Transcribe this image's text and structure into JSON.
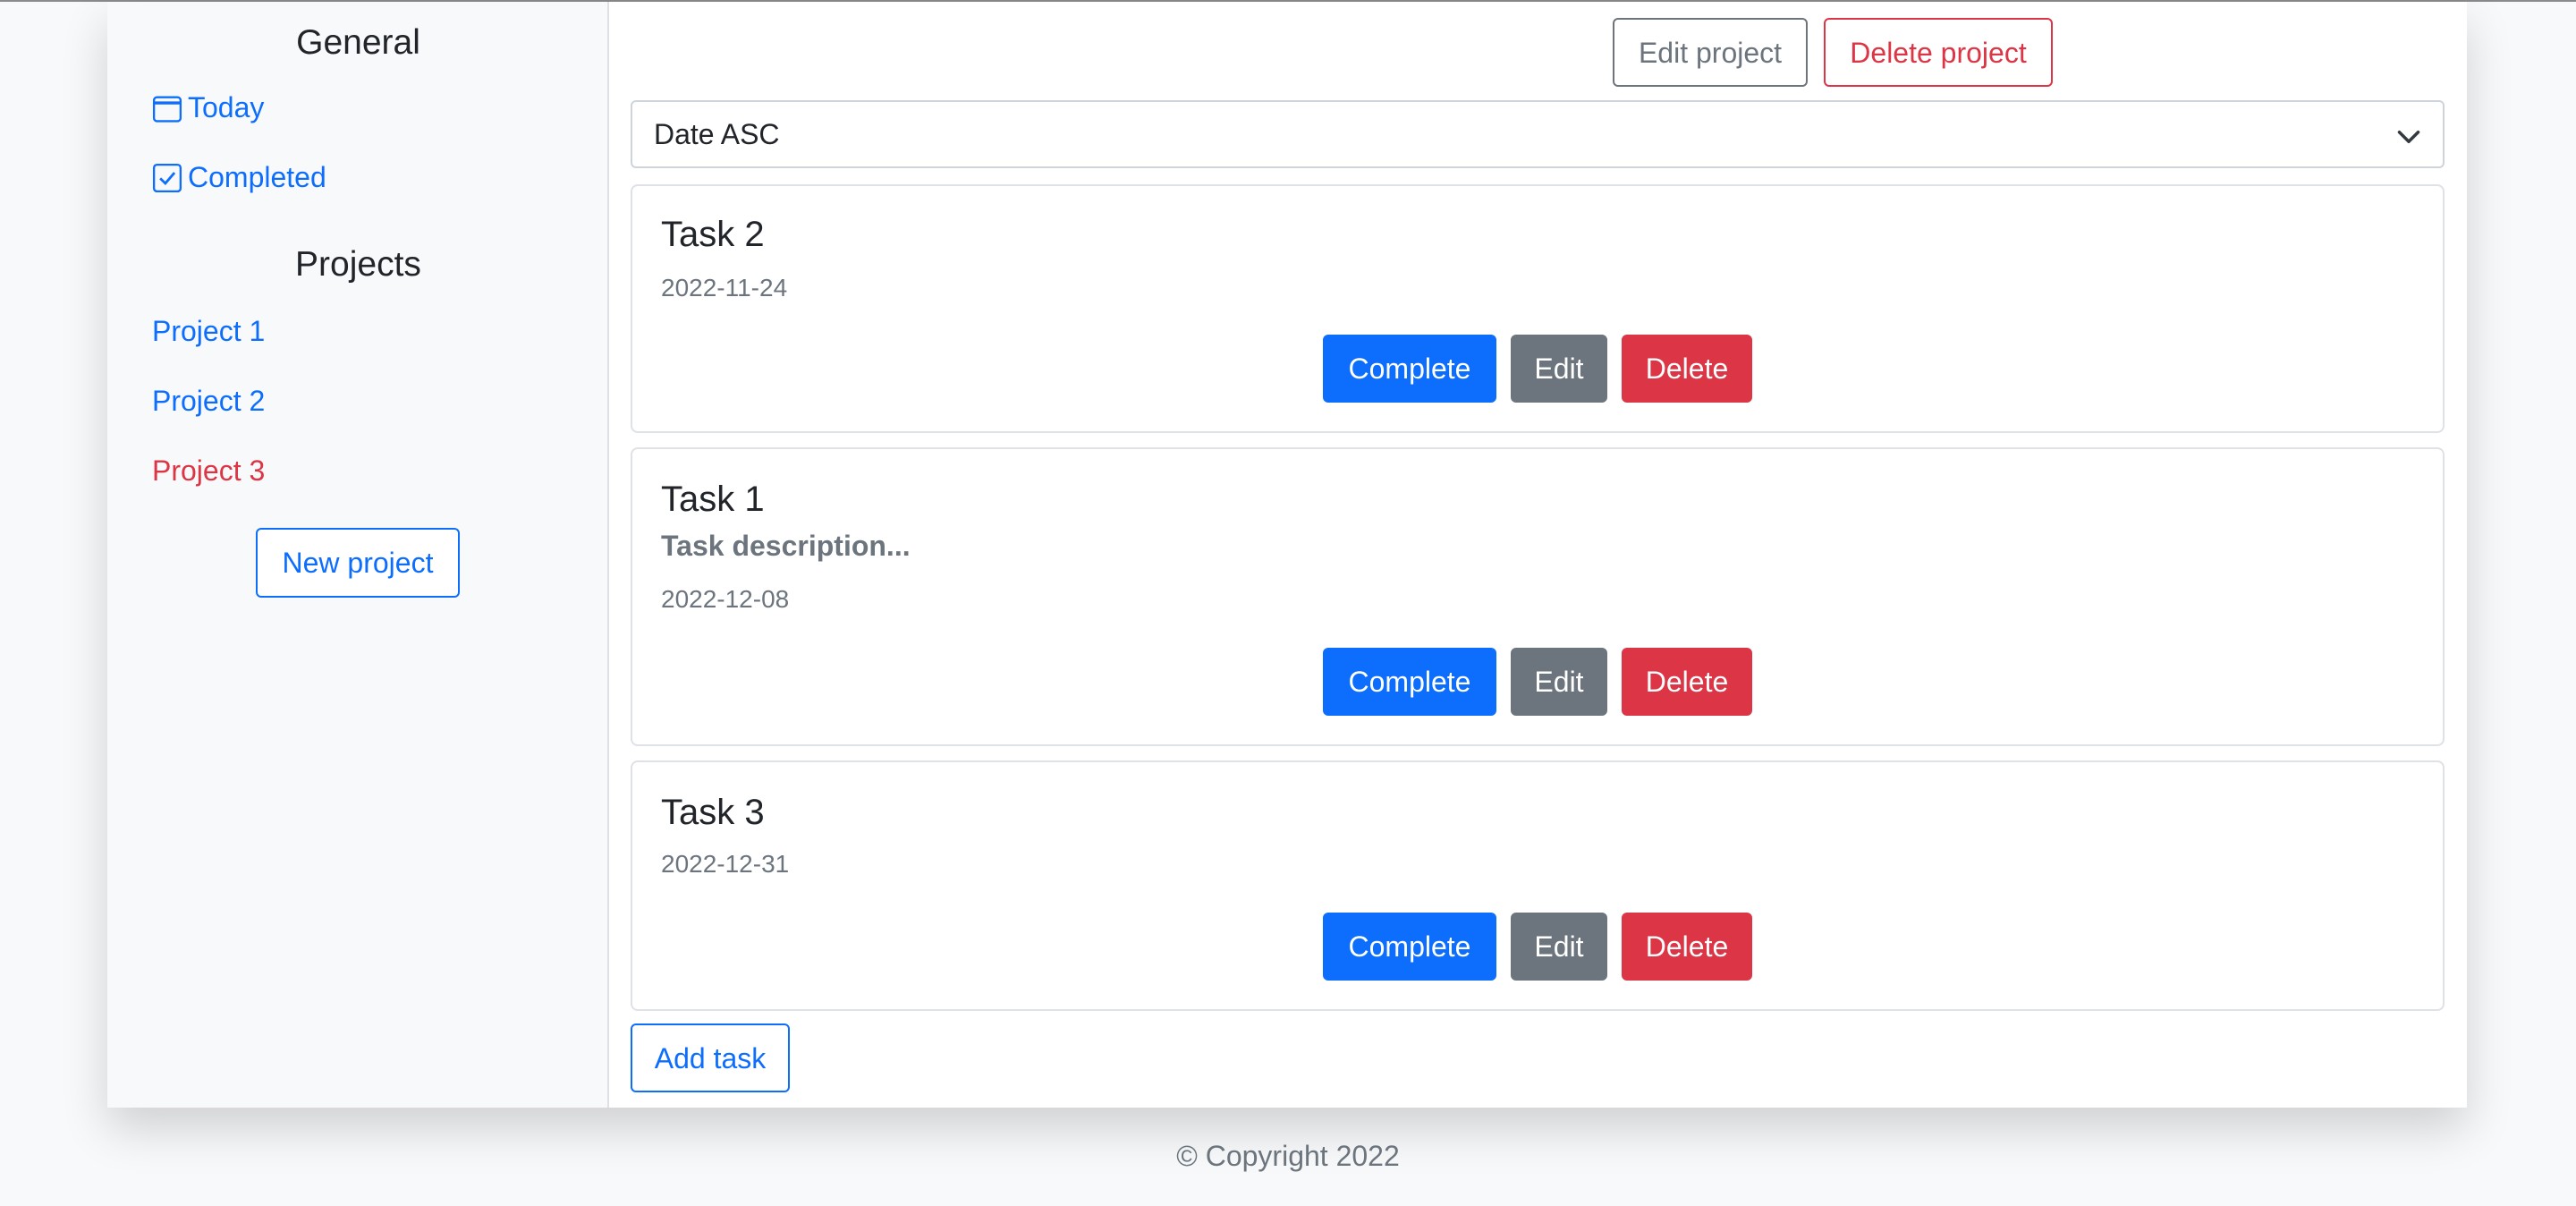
{
  "sidebar": {
    "general_heading": "General",
    "general_links": [
      {
        "label": "Today",
        "icon": "calendar-icon"
      },
      {
        "label": "Completed",
        "icon": "check-square-icon"
      }
    ],
    "projects_heading": "Projects",
    "projects": [
      {
        "label": "Project 1",
        "active": false
      },
      {
        "label": "Project 2",
        "active": false
      },
      {
        "label": "Project 3",
        "active": true
      }
    ],
    "new_project_label": "New project"
  },
  "header": {
    "edit_project_label": "Edit project",
    "delete_project_label": "Delete project"
  },
  "sort": {
    "selected": "Date ASC"
  },
  "tasks": [
    {
      "title": "Task 2",
      "description": "",
      "date": "2022-11-24"
    },
    {
      "title": "Task 1",
      "description": "Task description...",
      "date": "2022-12-08"
    },
    {
      "title": "Task 3",
      "description": "",
      "date": "2022-12-31"
    }
  ],
  "task_actions": {
    "complete_label": "Complete",
    "edit_label": "Edit",
    "delete_label": "Delete"
  },
  "add_task_label": "Add task",
  "footer": {
    "copyright": "© Copyright 2022"
  },
  "colors": {
    "primary": "#0d6efd",
    "secondary": "#6c757d",
    "danger": "#dc3545",
    "active_project": "#dc3545"
  }
}
